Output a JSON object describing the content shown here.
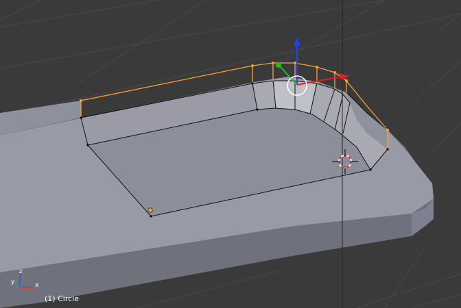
{
  "viewport": {
    "object_label": "(1) Circle",
    "mode": "Edit Mode",
    "selected_edge_color": "#ffa030",
    "active_vertex_color": "#ffffff"
  },
  "axis_gizmo": {
    "x_label": "x",
    "y_label": "y",
    "z_label": "z"
  },
  "manipulator": {
    "x_color": "#e02020",
    "y_color": "#20c020",
    "z_color": "#2040ff"
  },
  "colors": {
    "background": "#3a3a3a",
    "grid": "#505050",
    "mesh_face": "#9a9ba6",
    "mesh_side": "#7d7f8c",
    "edge": "#000000"
  }
}
